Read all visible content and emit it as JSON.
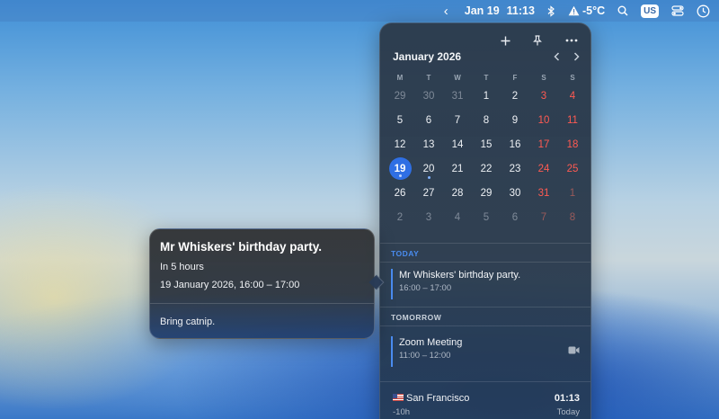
{
  "menubar": {
    "chevron": "‹",
    "date": "Jan 19",
    "time": "11:13",
    "weather": "-5°C",
    "input_source": "US"
  },
  "calendar": {
    "month_label": "January 2026",
    "weekdays": [
      "M",
      "T",
      "W",
      "T",
      "F",
      "S",
      "S"
    ],
    "weeks": [
      [
        {
          "d": "29",
          "o": true
        },
        {
          "d": "30",
          "o": true
        },
        {
          "d": "31",
          "o": true
        },
        {
          "d": "1"
        },
        {
          "d": "2"
        },
        {
          "d": "3",
          "w": true
        },
        {
          "d": "4",
          "w": true
        }
      ],
      [
        {
          "d": "5"
        },
        {
          "d": "6"
        },
        {
          "d": "7"
        },
        {
          "d": "8"
        },
        {
          "d": "9"
        },
        {
          "d": "10",
          "w": true
        },
        {
          "d": "11",
          "w": true
        }
      ],
      [
        {
          "d": "12"
        },
        {
          "d": "13"
        },
        {
          "d": "14"
        },
        {
          "d": "15"
        },
        {
          "d": "16"
        },
        {
          "d": "17",
          "w": true
        },
        {
          "d": "18",
          "w": true
        }
      ],
      [
        {
          "d": "19",
          "t": true,
          "e": true
        },
        {
          "d": "20",
          "e": true
        },
        {
          "d": "21"
        },
        {
          "d": "22"
        },
        {
          "d": "23"
        },
        {
          "d": "24",
          "w": true
        },
        {
          "d": "25",
          "w": true
        }
      ],
      [
        {
          "d": "26"
        },
        {
          "d": "27"
        },
        {
          "d": "28"
        },
        {
          "d": "29"
        },
        {
          "d": "30"
        },
        {
          "d": "31",
          "w": true
        },
        {
          "d": "1",
          "w": true,
          "o": true
        }
      ],
      [
        {
          "d": "2",
          "o": true
        },
        {
          "d": "3",
          "o": true
        },
        {
          "d": "4",
          "o": true
        },
        {
          "d": "5",
          "o": true
        },
        {
          "d": "6",
          "o": true
        },
        {
          "d": "7",
          "w": true,
          "o": true
        },
        {
          "d": "8",
          "w": true,
          "o": true
        }
      ]
    ]
  },
  "agenda": {
    "today_header": "TODAY",
    "today_event": {
      "title": "Mr Whiskers' birthday party.",
      "time": "16:00 – 17:00"
    },
    "tomorrow_header": "TOMORROW",
    "tomorrow_event": {
      "title": "Zoom Meeting",
      "time": "11:00 – 12:00"
    }
  },
  "world_clock": {
    "city": "San Francisco",
    "offset": "-10h",
    "time": "01:13",
    "day": "Today"
  },
  "popover": {
    "title": "Mr Whiskers' birthday party.",
    "relative": "In 5 hours",
    "when": "19 January 2026, 16:00 – 17:00",
    "notes": "Bring catnip."
  },
  "colors": {
    "accent": "#2f6fe4",
    "weekend": "#ff5a52",
    "event_bar": "#4a8cf0"
  }
}
